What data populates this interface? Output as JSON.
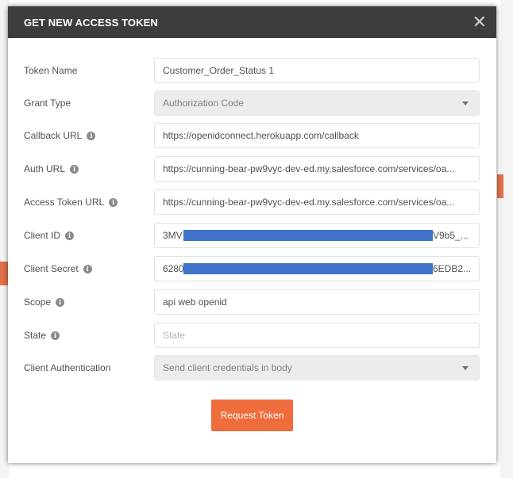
{
  "dialog": {
    "title": "GET NEW ACCESS TOKEN",
    "close_icon": "close-icon"
  },
  "fields": {
    "token_name": {
      "label": "Token Name",
      "value": "Customer_Order_Status 1"
    },
    "grant_type": {
      "label": "Grant Type",
      "value": "Authorization Code"
    },
    "callback_url": {
      "label": "Callback URL",
      "value": "https://openidconnect.herokuapp.com/callback"
    },
    "auth_url": {
      "label": "Auth URL",
      "value": "https://cunning-bear-pw9vyc-dev-ed.my.salesforce.com/services/oa..."
    },
    "access_token_url": {
      "label": "Access Token URL",
      "value": "https://cunning-bear-pw9vyc-dev-ed.my.salesforce.com/services/oa..."
    },
    "client_id": {
      "label": "Client ID",
      "value_prefix": "3MV",
      "value_suffix": "V9b5_..."
    },
    "client_secret": {
      "label": "Client Secret",
      "value_prefix": "6280",
      "value_suffix": "6EDB2..."
    },
    "scope": {
      "label": "Scope",
      "value": "api web openid"
    },
    "state": {
      "label": "State",
      "placeholder": "State"
    },
    "client_auth": {
      "label": "Client Authentication",
      "value": "Send client credentials in body"
    }
  },
  "info_icon_glyph": "i",
  "request_button": {
    "label": "Request Token",
    "color": "#ef6c3c"
  },
  "colors": {
    "header_bg": "#3d3d3d",
    "redaction": "#3e73c9"
  }
}
